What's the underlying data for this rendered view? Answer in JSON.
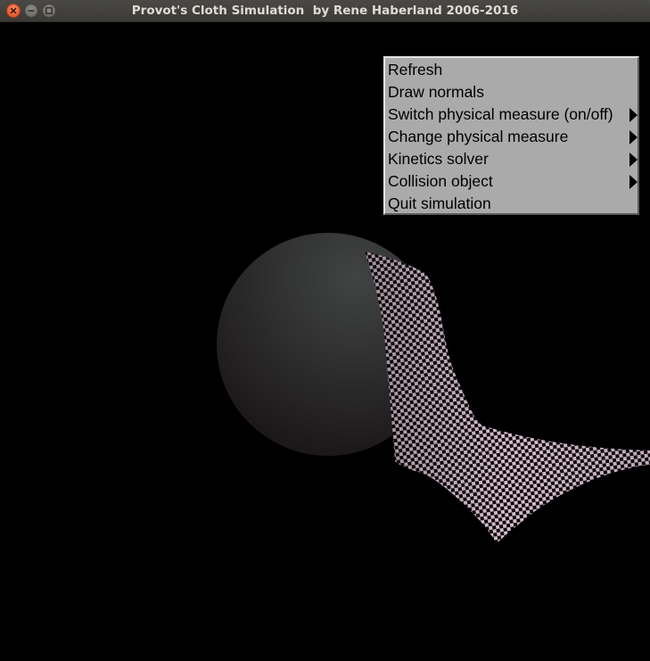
{
  "window": {
    "title": "Provot's Cloth Simulation  by Rene Haberland 2006-2016",
    "controls": [
      "close-icon",
      "minimize-icon",
      "maximize-icon"
    ]
  },
  "scene": {
    "background": "#000000",
    "collision_object": "sphere",
    "sphere_color": "#3a3a3a",
    "cloth_pattern": "checkerboard",
    "cloth_colors": [
      "#d6bccc",
      "#0a0a0a"
    ]
  },
  "menu": {
    "items": [
      {
        "label": "Refresh",
        "submenu": false
      },
      {
        "label": "Draw normals",
        "submenu": false
      },
      {
        "label": "Switch physical measure (on/off)",
        "submenu": true
      },
      {
        "label": "Change physical measure",
        "submenu": true
      },
      {
        "label": "Kinetics solver",
        "submenu": true
      },
      {
        "label": "Collision object",
        "submenu": true
      },
      {
        "label": "Quit simulation",
        "submenu": false
      }
    ]
  }
}
